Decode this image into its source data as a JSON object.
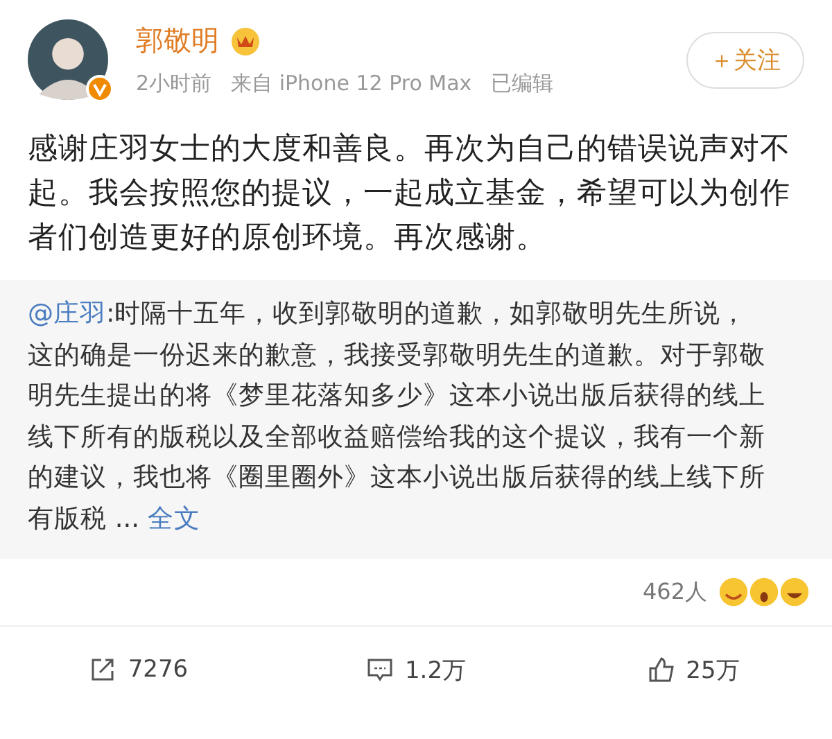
{
  "author": {
    "name": "郭敬明",
    "verified": true,
    "follow_button": "＋关注"
  },
  "meta": [
    "2小时前",
    "来自 iPhone 12 Pro Max",
    "已编辑"
  ],
  "post_text": "感谢庄羽女士的大度和善良。再次为自己的错误说声对不起。我会按照您的提议，一起成立基金，希望可以为创作者们创造更好的原创环境。再次感谢。",
  "quote": {
    "mention": "@庄羽",
    "text": ":时隔十五年，收到郭敬明的道歉，如郭敬明先生所说，这的确是一份迟来的歉意，我接受郭敬明先生的道歉。对于郭敬明先生提出的将《梦里花落知多少》这本小说出版后获得的线上线下所有的版税以及全部收益赔偿给我的这个提议，我有一个新的建议，我也将《圈里圈外》这本小说出版后获得的线上线下所有版税 ...",
    "more": "全文"
  },
  "reactions": {
    "count": "462人"
  },
  "actions": [
    {
      "kind": "share",
      "count": "7276"
    },
    {
      "kind": "comment",
      "count": "1.2万"
    },
    {
      "kind": "like",
      "count": "25万"
    }
  ]
}
